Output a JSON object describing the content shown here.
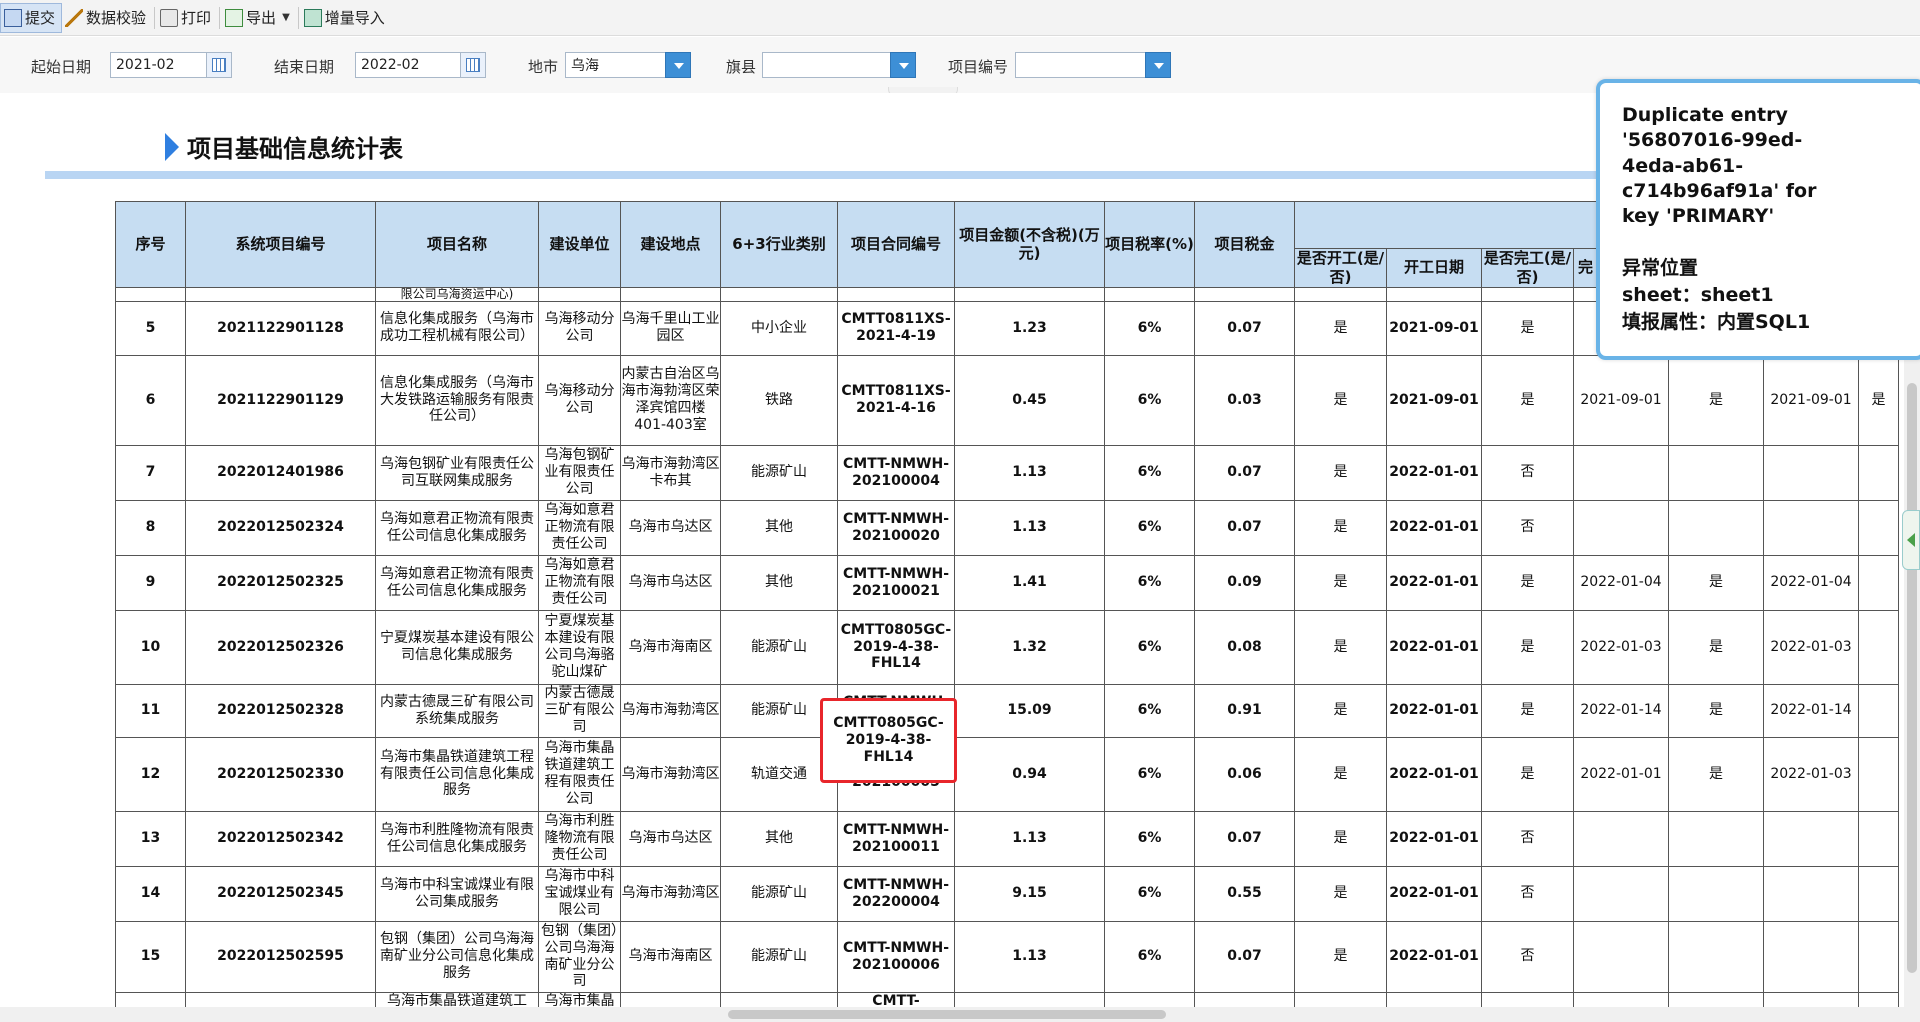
{
  "toolbar": {
    "buttons": [
      {
        "label": "提交",
        "icon": "submit-icon"
      },
      {
        "label": "数据校验",
        "icon": "pencil-check-icon"
      },
      {
        "label": "打印",
        "icon": "printer-icon"
      },
      {
        "label": "导出",
        "icon": "export-icon"
      },
      {
        "label": "增量导入",
        "icon": "import-icon"
      }
    ]
  },
  "filters": {
    "start_date": {
      "label": "起始日期",
      "value": "2021-02"
    },
    "end_date": {
      "label": "结束日期",
      "value": "2022-02"
    },
    "city": {
      "label": "地市",
      "value": "乌海"
    },
    "county": {
      "label": "旗县",
      "value": ""
    },
    "project_no": {
      "label": "项目编号",
      "value": ""
    }
  },
  "report": {
    "title": "项目基础信息统计表"
  },
  "table": {
    "headers": [
      "序号",
      "系统项目编号",
      "项目名称",
      "建设单位",
      "建设地点",
      "6+3行业类别",
      "项目合同编号",
      "项目金额(不含税)(万元)",
      "项目税率(%)",
      "项目税金",
      "是否开工(是/否)",
      "开工日期",
      "是否完工(是/否)",
      "完",
      "",
      "",
      ""
    ],
    "partial_row": {
      "name": "限公司乌海资运中心)"
    },
    "rows": [
      {
        "no": "5",
        "sys_id": "2021122901128",
        "name": "信息化集成服务（乌海市成功工程机械有限公司）",
        "unit": "乌海移动分公司",
        "place": "乌海千里山工业园区",
        "industry": "中小企业",
        "contract": "CMTT0811XS-2021-4-19",
        "amount": "1.23",
        "rate": "6%",
        "tax": "0.07",
        "started": "是",
        "start_date": "2021-09-01",
        "done": "是",
        "c1": "202",
        "c2": "",
        "c3": "",
        "c4": ""
      },
      {
        "no": "6",
        "sys_id": "2021122901129",
        "name": "信息化集成服务（乌海市大发铁路运输服务有限责任公司）",
        "unit": "乌海移动分公司",
        "place": "内蒙古自治区乌海市海勃湾区荣泽宾馆四楼401-403室",
        "industry": "铁路",
        "contract": "CMTT0811XS-2021-4-16",
        "amount": "0.45",
        "rate": "6%",
        "tax": "0.03",
        "started": "是",
        "start_date": "2021-09-01",
        "done": "是",
        "c1": "2021-09-01",
        "c2": "是",
        "c3": "2021-09-01",
        "c4": "是"
      },
      {
        "no": "7",
        "sys_id": "2022012401986",
        "name": "乌海包钢矿业有限责任公司互联网集成服务",
        "unit": "乌海包钢矿业有限责任公司",
        "place": "乌海市海勃湾区卡布其",
        "industry": "能源矿山",
        "contract": "CMTT-NMWH-202100004",
        "amount": "1.13",
        "rate": "6%",
        "tax": "0.07",
        "started": "是",
        "start_date": "2022-01-01",
        "done": "否",
        "c1": "",
        "c2": "",
        "c3": "",
        "c4": ""
      },
      {
        "no": "8",
        "sys_id": "2022012502324",
        "name": "乌海如意君正物流有限责任公司信息化集成服务",
        "unit": "乌海如意君正物流有限责任公司",
        "place": "乌海市乌达区",
        "industry": "其他",
        "contract": "CMTT-NMWH-202100020",
        "amount": "1.13",
        "rate": "6%",
        "tax": "0.07",
        "started": "是",
        "start_date": "2022-01-01",
        "done": "否",
        "c1": "",
        "c2": "",
        "c3": "",
        "c4": ""
      },
      {
        "no": "9",
        "sys_id": "2022012502325",
        "name": "乌海如意君正物流有限责任公司信息化集成服务",
        "unit": "乌海如意君正物流有限责任公司",
        "place": "乌海市乌达区",
        "industry": "其他",
        "contract": "CMTT-NMWH-202100021",
        "amount": "1.41",
        "rate": "6%",
        "tax": "0.09",
        "started": "是",
        "start_date": "2022-01-01",
        "done": "是",
        "c1": "2022-01-04",
        "c2": "是",
        "c3": "2022-01-04",
        "c4": ""
      },
      {
        "no": "10",
        "sys_id": "2022012502326",
        "name": "宁夏煤炭基本建设有限公司信息化集成服务",
        "unit": "宁夏煤炭基本建设有限公司乌海骆驼山煤矿",
        "place": "乌海市海南区",
        "industry": "能源矿山",
        "contract": "CMTT0805GC-2019-4-38-FHL14",
        "amount": "1.32",
        "rate": "6%",
        "tax": "0.08",
        "started": "是",
        "start_date": "2022-01-01",
        "done": "是",
        "c1": "2022-01-03",
        "c2": "是",
        "c3": "2022-01-03",
        "c4": ""
      },
      {
        "no": "11",
        "sys_id": "2022012502328",
        "name": "内蒙古德晟三矿有限公司系统集成服务",
        "unit": "内蒙古德晟三矿有限公司",
        "place": "乌海市海勃湾区",
        "industry": "能源矿山",
        "contract": "CMTT-NMWH-202100013",
        "amount": "15.09",
        "rate": "6%",
        "tax": "0.91",
        "started": "是",
        "start_date": "2022-01-01",
        "done": "是",
        "c1": "2022-01-14",
        "c2": "是",
        "c3": "2022-01-14",
        "c4": ""
      },
      {
        "no": "12",
        "sys_id": "2022012502330",
        "name": "乌海市集晶铁道建筑工程有限责任公司信息化集成服务",
        "unit": "乌海市集晶铁道建筑工程有限责任公司",
        "place": "乌海市海勃湾区",
        "industry": "轨道交通",
        "contract": "CMTT-NMWH-202100005",
        "amount": "0.94",
        "rate": "6%",
        "tax": "0.06",
        "started": "是",
        "start_date": "2022-01-01",
        "done": "是",
        "c1": "2022-01-01",
        "c2": "是",
        "c3": "2022-01-03",
        "c4": ""
      },
      {
        "no": "13",
        "sys_id": "2022012502342",
        "name": "乌海市利胜隆物流有限责任公司信息化集成服务",
        "unit": "乌海市利胜隆物流有限责任公司",
        "place": "乌海市乌达区",
        "industry": "其他",
        "contract": "CMTT-NMWH-202100011",
        "amount": "1.13",
        "rate": "6%",
        "tax": "0.07",
        "started": "是",
        "start_date": "2022-01-01",
        "done": "否",
        "c1": "",
        "c2": "",
        "c3": "",
        "c4": ""
      },
      {
        "no": "14",
        "sys_id": "2022012502345",
        "name": "乌海市中科宝诚煤业有限公司集成服务",
        "unit": "乌海市中科宝诚煤业有限公司",
        "place": "乌海市海勃湾区",
        "industry": "能源矿山",
        "contract": "CMTT-NMWH-202200004",
        "amount": "9.15",
        "rate": "6%",
        "tax": "0.55",
        "started": "是",
        "start_date": "2022-01-01",
        "done": "否",
        "c1": "",
        "c2": "",
        "c3": "",
        "c4": ""
      },
      {
        "no": "15",
        "sys_id": "2022012502595",
        "name": "包钢（集团）公司乌海海南矿业分公司信息化集成服务",
        "unit": "包钢（集团）公司乌海海南矿业分公司",
        "place": "乌海市海南区",
        "industry": "能源矿山",
        "contract": "CMTT-NMWH-202100006",
        "amount": "1.13",
        "rate": "6%",
        "tax": "0.07",
        "started": "是",
        "start_date": "2022-01-01",
        "done": "否",
        "c1": "",
        "c2": "",
        "c3": "",
        "c4": ""
      }
    ],
    "partial_bottom": {
      "name": "乌海市集晶铁道建筑工",
      "unit": "乌海市集晶",
      "contract": "CMTT-"
    }
  },
  "highlighted_contract": "CMTT0805GC-2019-4-38-FHL14",
  "error_tooltip": {
    "message": "Duplicate entry '56807016-99ed-4eda-ab61-c714b96af91a' for key 'PRIMARY'",
    "location_label": "异常位置",
    "sheet_line": "sheet：sheet1",
    "attribute_line": "填报属性：内置SQL1"
  },
  "colors": {
    "header_bg": "#c6ddf2",
    "title_rule": "#b9d5f3",
    "highlight_border": "#e8262b",
    "tooltip_border": "#69b3e7",
    "dropdown_button": "#3d8fd6"
  }
}
